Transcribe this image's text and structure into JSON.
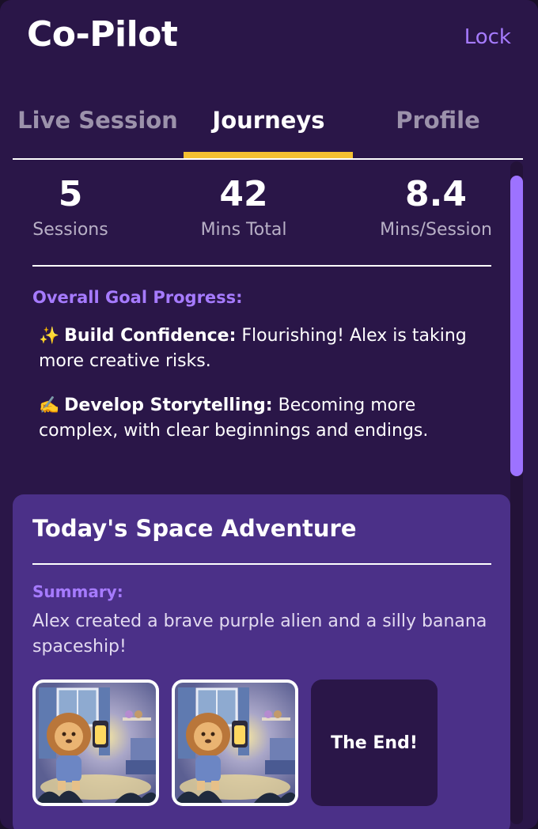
{
  "app": {
    "title": "Co-Pilot",
    "lock_label": "Lock",
    "colors": {
      "background": "#2a1648",
      "accent": "#a67bff",
      "tab_indicator": "#f4c030",
      "card": "#4b3088"
    }
  },
  "tabs": [
    {
      "label": "Live Session",
      "active": false
    },
    {
      "label": "Journeys",
      "active": true
    },
    {
      "label": "Profile",
      "active": false
    }
  ],
  "stats": [
    {
      "value": "5",
      "label": "Sessions"
    },
    {
      "value": "42",
      "label": "Mins Total"
    },
    {
      "value": "8.4",
      "label": "Mins/Session"
    }
  ],
  "goals": {
    "heading": "Overall Goal Progress:",
    "items": [
      {
        "emoji": "✨",
        "name": "Build Confidence:",
        "text": "Flourishing! Alex is taking more creative risks."
      },
      {
        "emoji": "✍️",
        "name": "Develop Storytelling:",
        "text": "Becoming more complex, with clear beginnings and endings."
      }
    ]
  },
  "session_card": {
    "title": "Today's Space Adventure",
    "summary_label": "Summary:",
    "summary_text": "Alex created a brave purple alien and a silly banana spaceship!",
    "thumbnails": [
      {
        "kind": "image",
        "icon": "lion-lantern-illustration"
      },
      {
        "kind": "image",
        "icon": "lion-lantern-illustration"
      },
      {
        "kind": "text",
        "label": "The End!"
      }
    ]
  }
}
